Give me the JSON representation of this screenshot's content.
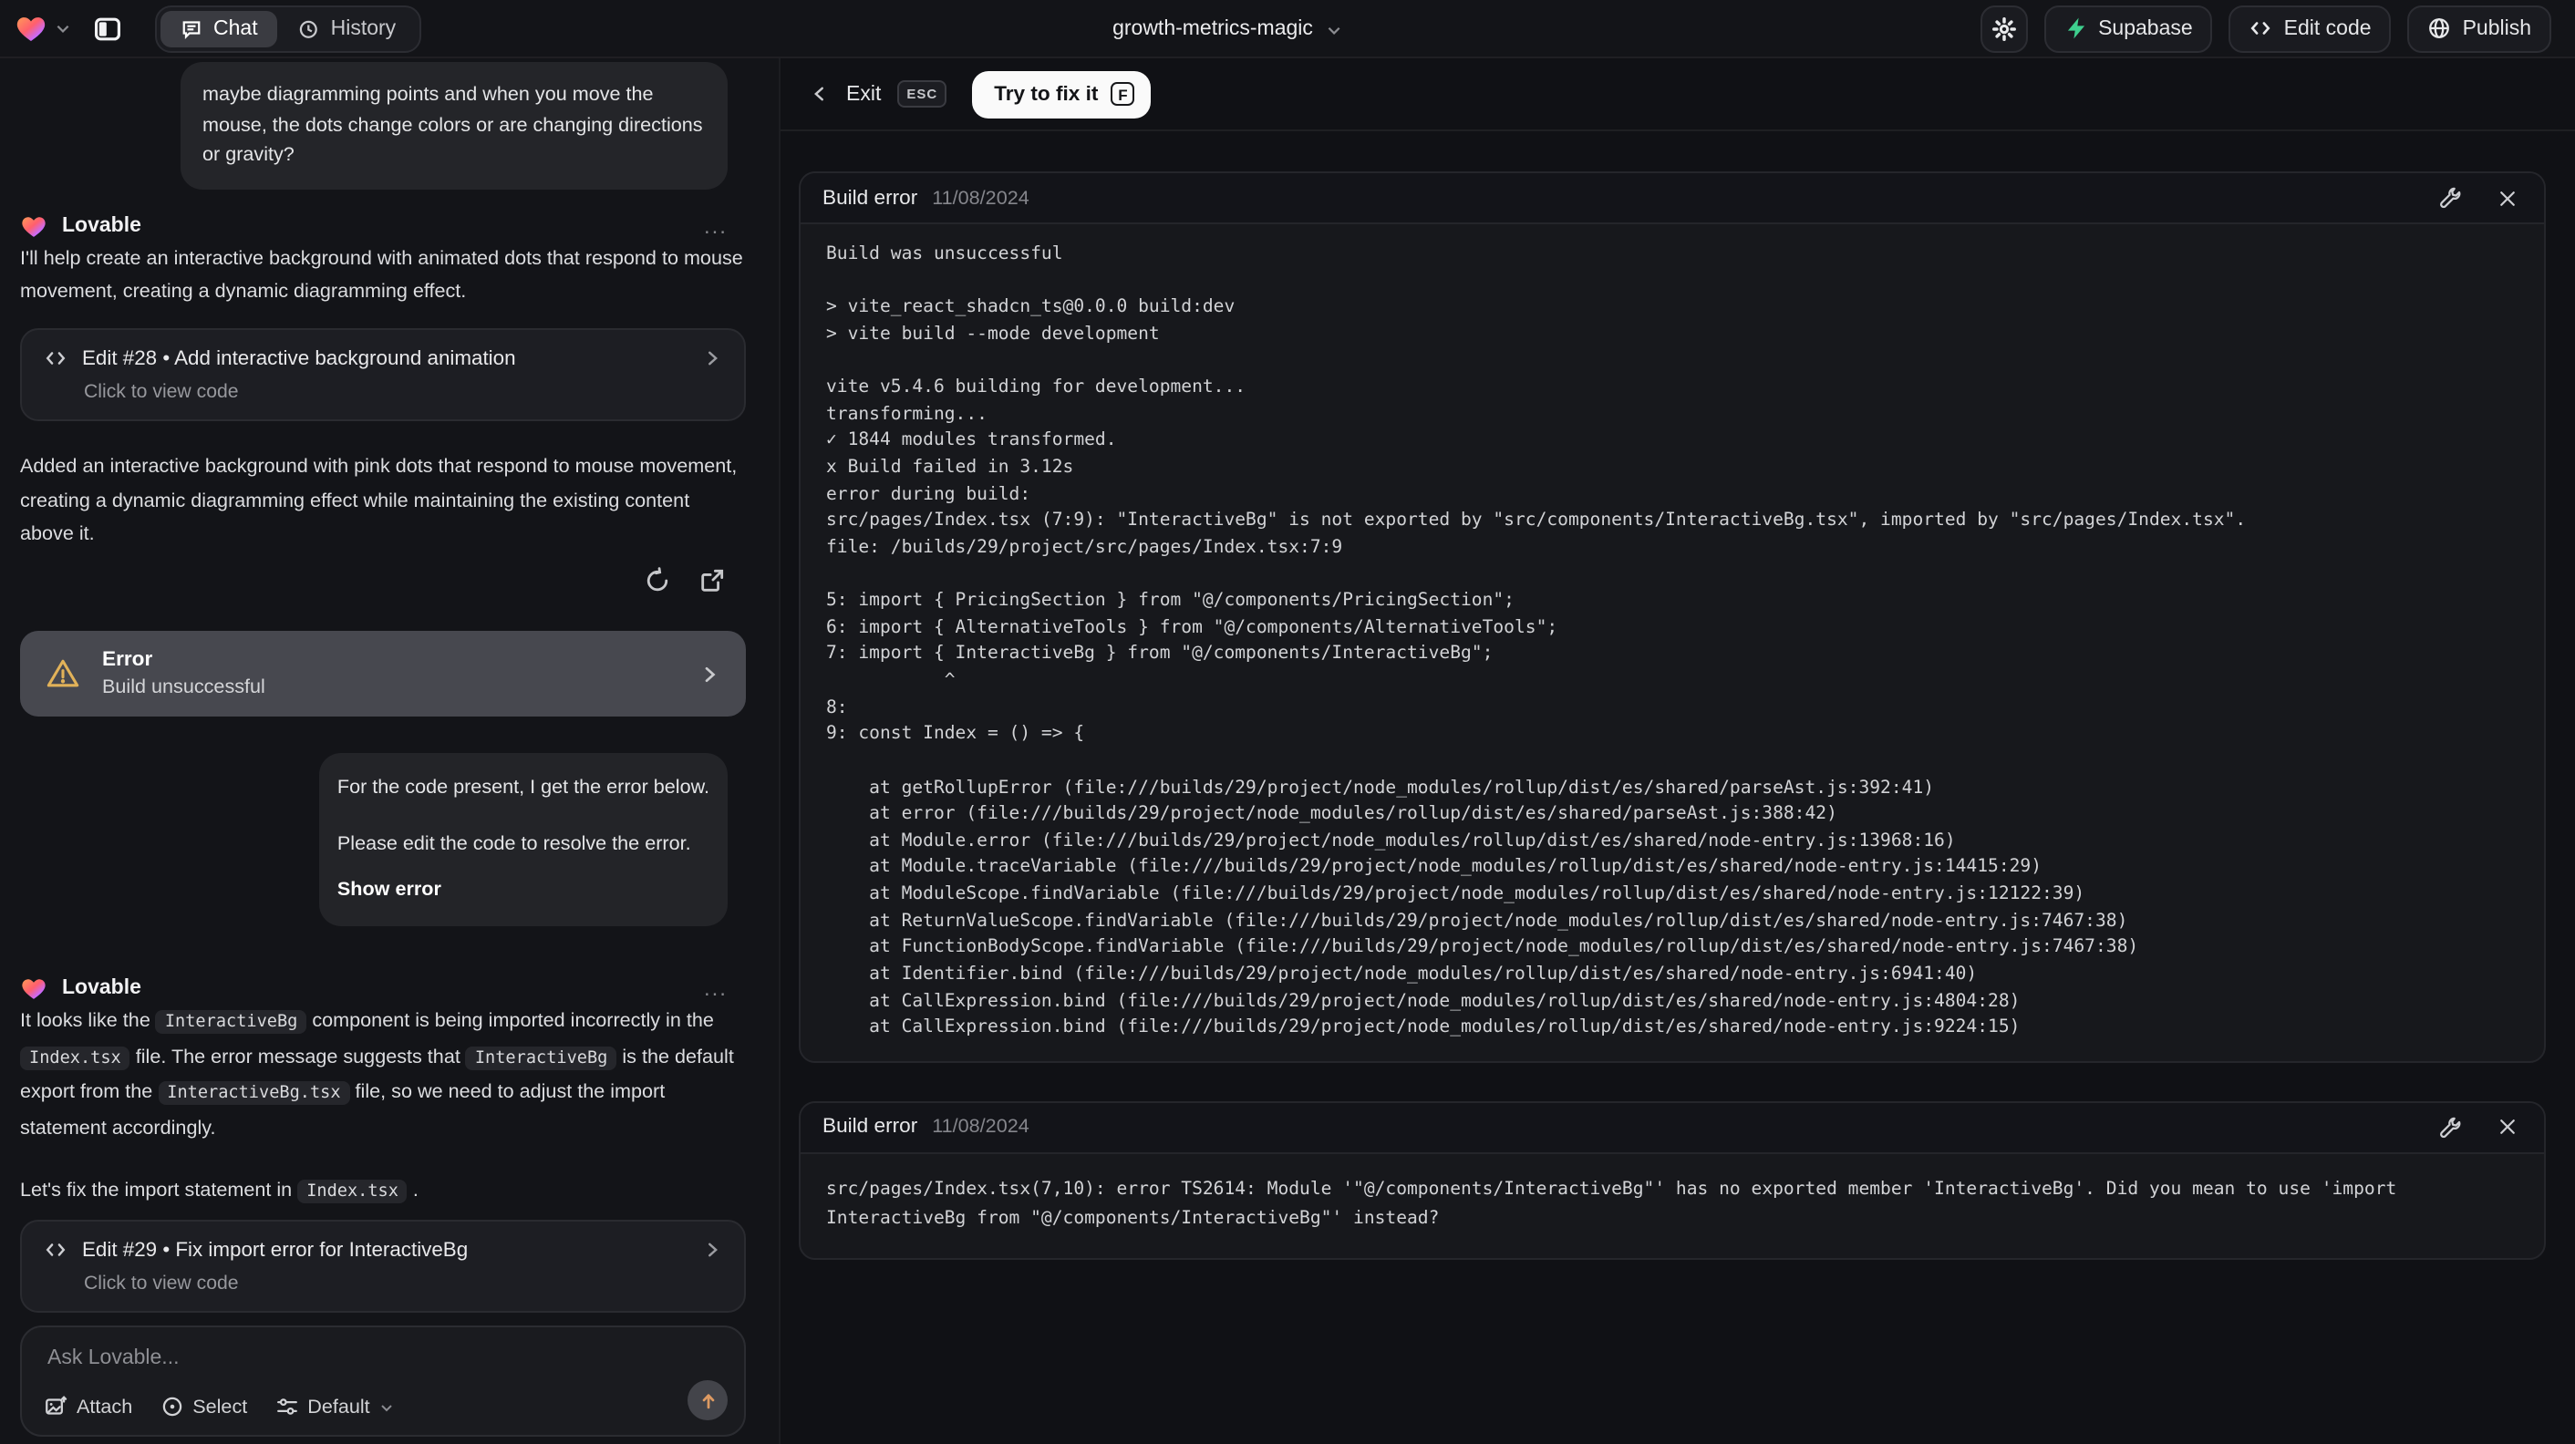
{
  "topbar": {
    "tabs": {
      "chat": "Chat",
      "history": "History"
    },
    "project": {
      "name": "growth-metrics-magic"
    },
    "actions": {
      "supabase": "Supabase",
      "edit_code": "Edit code",
      "publish": "Publish"
    }
  },
  "fixbar": {
    "exit": "Exit",
    "esc": "ESC",
    "try_fix": "Try to fix it",
    "shortcut": "F"
  },
  "chat": {
    "assistant": "Lovable",
    "menu_ellipsis": "...",
    "user_message_top": "maybe diagramming points and when you move the mouse, the dots change colors or are changing directions or gravity?",
    "reply1": {
      "intro": "I'll help create an interactive background with animated dots that respond to mouse movement, creating a dynamic diagramming effect.",
      "edit_card": {
        "title": "Edit #28 • Add interactive background animation",
        "subtitle": "Click to view code"
      },
      "summary": "Added an interactive background with pink dots that respond to mouse movement, creating a dynamic diagramming effect while maintaining the existing content above it.",
      "error_card": {
        "title": "Error",
        "subtitle": "Build unsuccessful"
      }
    },
    "user_error_request": {
      "p1": "For the code present, I get the error below.",
      "p2": "Please edit the code to resolve the error.",
      "action": "Show error"
    },
    "reply2": {
      "seg": {
        "t1": "It looks like the ",
        "c1": "InteractiveBg",
        "t2": " component is being imported incorrectly in the ",
        "c2": "Index.tsx",
        "t3": " file. The error message suggests that ",
        "c3": "InteractiveBg",
        "t4": " is the default export from the ",
        "c4": "InteractiveBg.tsx",
        "t5": " file, so we need to adjust the import statement accordingly."
      },
      "fix_line": {
        "t1": "Let's fix the import statement in ",
        "c1": "Index.tsx",
        "t2": " ."
      },
      "edit_card": {
        "title": "Edit #29 • Fix import error for InteractiveBg",
        "subtitle": "Click to view code"
      }
    },
    "composer": {
      "placeholder": "Ask Lovable...",
      "attach": "Attach",
      "select": "Select",
      "model": "Default"
    }
  },
  "build_errors": [
    {
      "title": "Build error",
      "date": "11/08/2024",
      "log": [
        "Build was unsuccessful",
        "",
        "> vite_react_shadcn_ts@0.0.0 build:dev",
        "> vite build --mode development",
        "",
        "vite v5.4.6 building for development...",
        "transforming...",
        "✓ 1844 modules transformed.",
        "x Build failed in 3.12s",
        "error during build:",
        "src/pages/Index.tsx (7:9): \"InteractiveBg\" is not exported by \"src/components/InteractiveBg.tsx\", imported by \"src/pages/Index.tsx\".",
        "file: /builds/29/project/src/pages/Index.tsx:7:9",
        "",
        "5: import { PricingSection } from \"@/components/PricingSection\";",
        "6: import { AlternativeTools } from \"@/components/AlternativeTools\";",
        "7: import { InteractiveBg } from \"@/components/InteractiveBg\";",
        "           ^",
        "8:",
        "9: const Index = () => {",
        "",
        "    at getRollupError (file:///builds/29/project/node_modules/rollup/dist/es/shared/parseAst.js:392:41)",
        "    at error (file:///builds/29/project/node_modules/rollup/dist/es/shared/parseAst.js:388:42)",
        "    at Module.error (file:///builds/29/project/node_modules/rollup/dist/es/shared/node-entry.js:13968:16)",
        "    at Module.traceVariable (file:///builds/29/project/node_modules/rollup/dist/es/shared/node-entry.js:14415:29)",
        "    at ModuleScope.findVariable (file:///builds/29/project/node_modules/rollup/dist/es/shared/node-entry.js:12122:39)",
        "    at ReturnValueScope.findVariable (file:///builds/29/project/node_modules/rollup/dist/es/shared/node-entry.js:7467:38)",
        "    at FunctionBodyScope.findVariable (file:///builds/29/project/node_modules/rollup/dist/es/shared/node-entry.js:7467:38)",
        "    at Identifier.bind (file:///builds/29/project/node_modules/rollup/dist/es/shared/node-entry.js:6941:40)",
        "    at CallExpression.bind (file:///builds/29/project/node_modules/rollup/dist/es/shared/node-entry.js:4804:28)",
        "    at CallExpression.bind (file:///builds/29/project/node_modules/rollup/dist/es/shared/node-entry.js:9224:15)"
      ]
    },
    {
      "title": "Build error",
      "date": "11/08/2024",
      "message": "src/pages/Index.tsx(7,10): error TS2614: Module '\"@/components/InteractiveBg\"' has no exported member 'InteractiveBg'. Did you mean to use 'import InteractiveBg from \"@/components/InteractiveBg\"' instead?"
    }
  ],
  "colors": {
    "supabase_green": "#3ecf8e",
    "warning_amber": "#e2b259",
    "send_arrow": "#dd9a62",
    "fix_button_bg": "#fafafa"
  }
}
